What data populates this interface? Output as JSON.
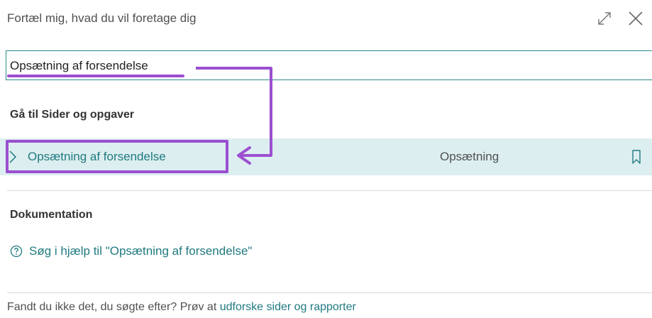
{
  "header": {
    "title": "Fortæl mig, hvad du vil foretage dig",
    "icons": [
      "expand-icon",
      "close-icon"
    ]
  },
  "search": {
    "value": "Opsætning af forsendelse"
  },
  "sections": {
    "pages_heading": "Gå til Sider og opgaver",
    "docs_heading": "Dokumentation"
  },
  "result": {
    "label": "Opsætning af forsendelse",
    "category": "Opsætning",
    "icons": [
      "chevron-right-icon",
      "bookmark-icon"
    ]
  },
  "help": {
    "text": "Søg i hjælp til \"Opsætning af forsendelse\"",
    "icon": "question-circle-icon"
  },
  "footer": {
    "prefix": "Fandt du ikke det, du søgte efter? Prøv at ",
    "link": "udforske sider og rapporter"
  },
  "colors": {
    "accent": "#1f7a80",
    "row_highlight": "#ddeef0",
    "annotation": "#9b4fd0"
  }
}
